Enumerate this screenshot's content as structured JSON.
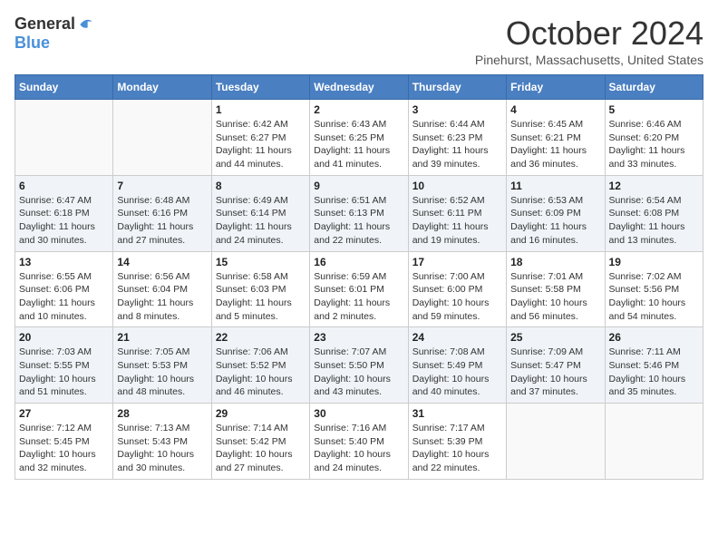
{
  "logo": {
    "general": "General",
    "blue": "Blue"
  },
  "title": "October 2024",
  "subtitle": "Pinehurst, Massachusetts, United States",
  "days_of_week": [
    "Sunday",
    "Monday",
    "Tuesday",
    "Wednesday",
    "Thursday",
    "Friday",
    "Saturday"
  ],
  "weeks": [
    [
      {
        "day": "",
        "info": ""
      },
      {
        "day": "",
        "info": ""
      },
      {
        "day": "1",
        "sunrise": "Sunrise: 6:42 AM",
        "sunset": "Sunset: 6:27 PM",
        "daylight": "Daylight: 11 hours and 44 minutes."
      },
      {
        "day": "2",
        "sunrise": "Sunrise: 6:43 AM",
        "sunset": "Sunset: 6:25 PM",
        "daylight": "Daylight: 11 hours and 41 minutes."
      },
      {
        "day": "3",
        "sunrise": "Sunrise: 6:44 AM",
        "sunset": "Sunset: 6:23 PM",
        "daylight": "Daylight: 11 hours and 39 minutes."
      },
      {
        "day": "4",
        "sunrise": "Sunrise: 6:45 AM",
        "sunset": "Sunset: 6:21 PM",
        "daylight": "Daylight: 11 hours and 36 minutes."
      },
      {
        "day": "5",
        "sunrise": "Sunrise: 6:46 AM",
        "sunset": "Sunset: 6:20 PM",
        "daylight": "Daylight: 11 hours and 33 minutes."
      }
    ],
    [
      {
        "day": "6",
        "sunrise": "Sunrise: 6:47 AM",
        "sunset": "Sunset: 6:18 PM",
        "daylight": "Daylight: 11 hours and 30 minutes."
      },
      {
        "day": "7",
        "sunrise": "Sunrise: 6:48 AM",
        "sunset": "Sunset: 6:16 PM",
        "daylight": "Daylight: 11 hours and 27 minutes."
      },
      {
        "day": "8",
        "sunrise": "Sunrise: 6:49 AM",
        "sunset": "Sunset: 6:14 PM",
        "daylight": "Daylight: 11 hours and 24 minutes."
      },
      {
        "day": "9",
        "sunrise": "Sunrise: 6:51 AM",
        "sunset": "Sunset: 6:13 PM",
        "daylight": "Daylight: 11 hours and 22 minutes."
      },
      {
        "day": "10",
        "sunrise": "Sunrise: 6:52 AM",
        "sunset": "Sunset: 6:11 PM",
        "daylight": "Daylight: 11 hours and 19 minutes."
      },
      {
        "day": "11",
        "sunrise": "Sunrise: 6:53 AM",
        "sunset": "Sunset: 6:09 PM",
        "daylight": "Daylight: 11 hours and 16 minutes."
      },
      {
        "day": "12",
        "sunrise": "Sunrise: 6:54 AM",
        "sunset": "Sunset: 6:08 PM",
        "daylight": "Daylight: 11 hours and 13 minutes."
      }
    ],
    [
      {
        "day": "13",
        "sunrise": "Sunrise: 6:55 AM",
        "sunset": "Sunset: 6:06 PM",
        "daylight": "Daylight: 11 hours and 10 minutes."
      },
      {
        "day": "14",
        "sunrise": "Sunrise: 6:56 AM",
        "sunset": "Sunset: 6:04 PM",
        "daylight": "Daylight: 11 hours and 8 minutes."
      },
      {
        "day": "15",
        "sunrise": "Sunrise: 6:58 AM",
        "sunset": "Sunset: 6:03 PM",
        "daylight": "Daylight: 11 hours and 5 minutes."
      },
      {
        "day": "16",
        "sunrise": "Sunrise: 6:59 AM",
        "sunset": "Sunset: 6:01 PM",
        "daylight": "Daylight: 11 hours and 2 minutes."
      },
      {
        "day": "17",
        "sunrise": "Sunrise: 7:00 AM",
        "sunset": "Sunset: 6:00 PM",
        "daylight": "Daylight: 10 hours and 59 minutes."
      },
      {
        "day": "18",
        "sunrise": "Sunrise: 7:01 AM",
        "sunset": "Sunset: 5:58 PM",
        "daylight": "Daylight: 10 hours and 56 minutes."
      },
      {
        "day": "19",
        "sunrise": "Sunrise: 7:02 AM",
        "sunset": "Sunset: 5:56 PM",
        "daylight": "Daylight: 10 hours and 54 minutes."
      }
    ],
    [
      {
        "day": "20",
        "sunrise": "Sunrise: 7:03 AM",
        "sunset": "Sunset: 5:55 PM",
        "daylight": "Daylight: 10 hours and 51 minutes."
      },
      {
        "day": "21",
        "sunrise": "Sunrise: 7:05 AM",
        "sunset": "Sunset: 5:53 PM",
        "daylight": "Daylight: 10 hours and 48 minutes."
      },
      {
        "day": "22",
        "sunrise": "Sunrise: 7:06 AM",
        "sunset": "Sunset: 5:52 PM",
        "daylight": "Daylight: 10 hours and 46 minutes."
      },
      {
        "day": "23",
        "sunrise": "Sunrise: 7:07 AM",
        "sunset": "Sunset: 5:50 PM",
        "daylight": "Daylight: 10 hours and 43 minutes."
      },
      {
        "day": "24",
        "sunrise": "Sunrise: 7:08 AM",
        "sunset": "Sunset: 5:49 PM",
        "daylight": "Daylight: 10 hours and 40 minutes."
      },
      {
        "day": "25",
        "sunrise": "Sunrise: 7:09 AM",
        "sunset": "Sunset: 5:47 PM",
        "daylight": "Daylight: 10 hours and 37 minutes."
      },
      {
        "day": "26",
        "sunrise": "Sunrise: 7:11 AM",
        "sunset": "Sunset: 5:46 PM",
        "daylight": "Daylight: 10 hours and 35 minutes."
      }
    ],
    [
      {
        "day": "27",
        "sunrise": "Sunrise: 7:12 AM",
        "sunset": "Sunset: 5:45 PM",
        "daylight": "Daylight: 10 hours and 32 minutes."
      },
      {
        "day": "28",
        "sunrise": "Sunrise: 7:13 AM",
        "sunset": "Sunset: 5:43 PM",
        "daylight": "Daylight: 10 hours and 30 minutes."
      },
      {
        "day": "29",
        "sunrise": "Sunrise: 7:14 AM",
        "sunset": "Sunset: 5:42 PM",
        "daylight": "Daylight: 10 hours and 27 minutes."
      },
      {
        "day": "30",
        "sunrise": "Sunrise: 7:16 AM",
        "sunset": "Sunset: 5:40 PM",
        "daylight": "Daylight: 10 hours and 24 minutes."
      },
      {
        "day": "31",
        "sunrise": "Sunrise: 7:17 AM",
        "sunset": "Sunset: 5:39 PM",
        "daylight": "Daylight: 10 hours and 22 minutes."
      },
      {
        "day": "",
        "info": ""
      },
      {
        "day": "",
        "info": ""
      }
    ]
  ]
}
